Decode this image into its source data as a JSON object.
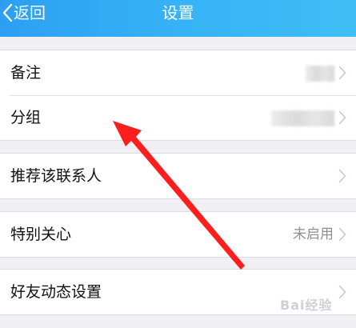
{
  "navbar": {
    "back_label": "返回",
    "title": "设置"
  },
  "sections": [
    {
      "rows": [
        {
          "label": "备注",
          "value_obscured": true
        },
        {
          "label": "分组",
          "value_obscured": true
        }
      ]
    },
    {
      "rows": [
        {
          "label": "推荐该联系人"
        }
      ]
    },
    {
      "rows": [
        {
          "label": "特别关心",
          "value": "未启用"
        }
      ]
    },
    {
      "rows": [
        {
          "label": "好友动态设置"
        }
      ]
    }
  ],
  "annotation": {
    "type": "red-arrow",
    "target": "分组",
    "color": "#ff1e1e"
  },
  "colors": {
    "nav_start": "#2c9ff2",
    "nav_end": "#3fbef5",
    "background": "#efeff4",
    "annotation": "#ff1e1e"
  },
  "watermark": {
    "text": "Bai经验"
  }
}
